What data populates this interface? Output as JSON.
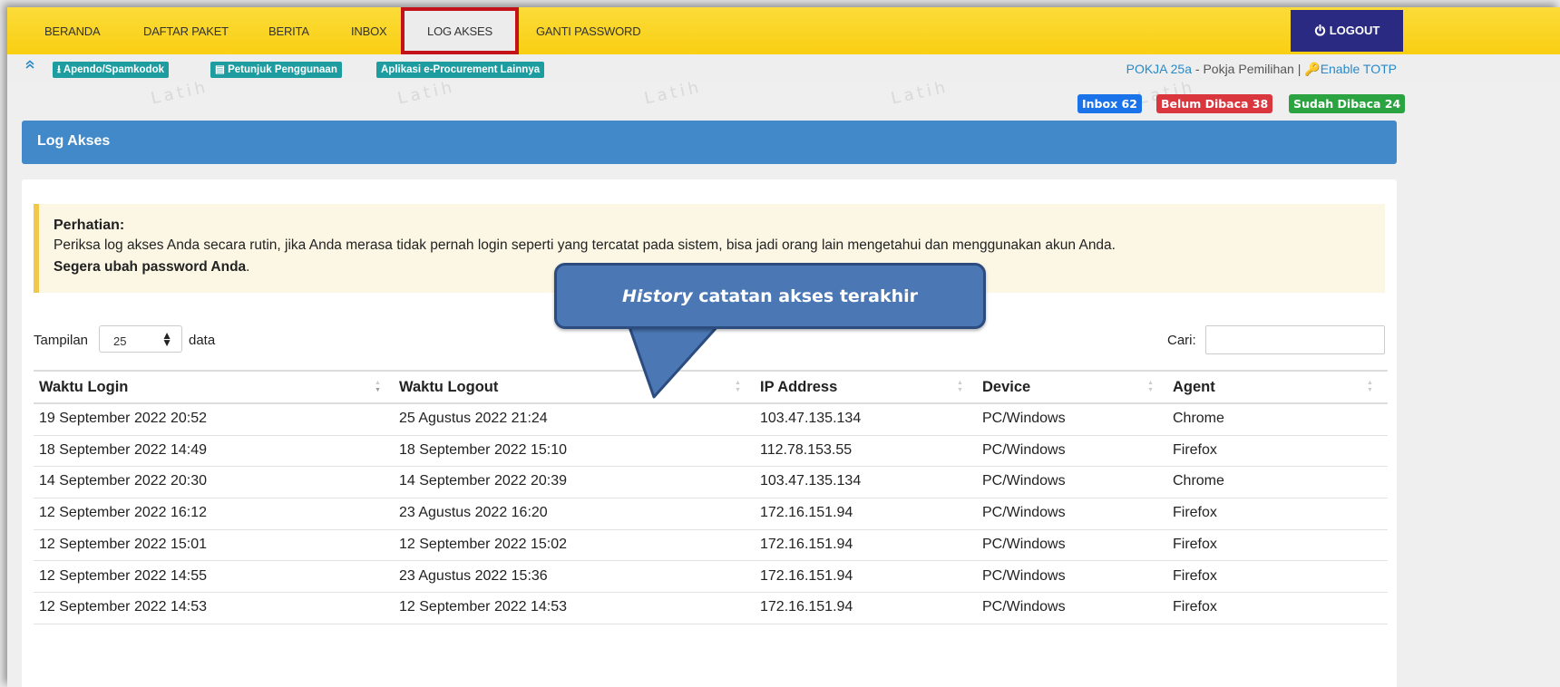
{
  "nav": {
    "items": [
      "BERANDA",
      "DAFTAR PAKET",
      "BERITA",
      "INBOX",
      "LOG AKSES",
      "GANTI PASSWORD"
    ],
    "active": "LOG AKSES",
    "logout": "LOGOUT"
  },
  "subbar": {
    "links": [
      "Apendo/Spamkodok",
      "Petunjuk Penggunaan",
      "Aplikasi e-Procurement Lainnya"
    ],
    "user": "POKJA 25a",
    "role": " - Pokja Pemilihan | ",
    "totp": "Enable TOTP"
  },
  "badges": {
    "inbox": "Inbox 62",
    "unread": "Belum Dibaca 38",
    "read": "Sudah Dibaca 24"
  },
  "watermark": "Latih",
  "panel": {
    "title": "Log Akses"
  },
  "alert": {
    "title": "Perhatian:",
    "text": "Periksa log akses Anda secara rutin, jika Anda merasa tidak pernah login seperti yang tercatat pada sistem, bisa jadi orang lain mengetahui dan menggunakan akun Anda.",
    "strong": "Segera ubah password Anda",
    "strong_suffix": "."
  },
  "controls": {
    "show_label": "Tampilan",
    "show_value": "25",
    "show_suffix": "data",
    "search_label": "Cari:",
    "search_value": ""
  },
  "callout": {
    "italic": "History",
    "rest": " catatan akses terakhir"
  },
  "table": {
    "headers": [
      "Waktu Login",
      "Waktu Logout",
      "IP Address",
      "Device",
      "Agent"
    ],
    "rows": [
      [
        "19 September 2022 20:52",
        "25 Agustus 2022 21:24",
        "103.47.135.134",
        "PC/Windows",
        "Chrome"
      ],
      [
        "18 September 2022 14:49",
        "18 September 2022 15:10",
        "112.78.153.55",
        "PC/Windows",
        "Firefox"
      ],
      [
        "14 September 2022 20:30",
        "14 September 2022 20:39",
        "103.47.135.134",
        "PC/Windows",
        "Chrome"
      ],
      [
        "12 September 2022 16:12",
        "23 Agustus 2022 16:20",
        "172.16.151.94",
        "PC/Windows",
        "Firefox"
      ],
      [
        "12 September 2022 15:01",
        "12 September 2022 15:02",
        "172.16.151.94",
        "PC/Windows",
        "Firefox"
      ],
      [
        "12 September 2022 14:55",
        "23 Agustus 2022 15:36",
        "172.16.151.94",
        "PC/Windows",
        "Firefox"
      ],
      [
        "12 September 2022 14:53",
        "12 September 2022 14:53",
        "172.16.151.94",
        "PC/Windows",
        "Firefox"
      ]
    ]
  },
  "colors": {
    "nav_bg": "#f9cf12",
    "logout_bg": "#2a2a83",
    "active_outline": "#c4121a",
    "panel_head": "#4289c9",
    "badge_inbox": "#1a73e8",
    "badge_unread": "#d9363e",
    "badge_read": "#2aa340",
    "tiny_btn": "#1d9da0"
  }
}
